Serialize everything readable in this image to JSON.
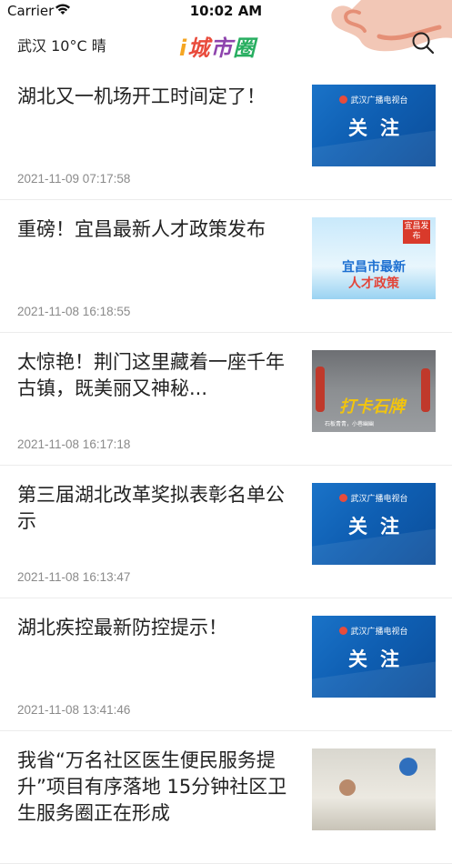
{
  "status_bar": {
    "carrier": "Carrier",
    "time": "10:02 AM"
  },
  "header": {
    "weather": "武汉 10°C 晴",
    "logo_chars": [
      "i",
      "城",
      "市",
      "圈",
      ""
    ],
    "search_icon": "search-icon"
  },
  "news": [
    {
      "title": "湖北又一机场开工时间定了！",
      "time": "2021-11-09 07:17:58",
      "thumb": {
        "type": "tv",
        "station": "武汉广播电视台",
        "text": "关注"
      }
    },
    {
      "title": "重磅！宜昌最新人才政策发布",
      "time": "2021-11-08 16:18:55",
      "thumb": {
        "type": "yichang",
        "badge": "宜昌发布",
        "line1": "宜昌市最新",
        "line2": "人才政策"
      }
    },
    {
      "title": "太惊艳！荆门这里藏着一座千年古镇，既美丽又神秘...",
      "time": "2021-11-08 16:17:18",
      "thumb": {
        "type": "town",
        "logo": "打卡石牌",
        "sub": "石板青青，小巷幽幽"
      }
    },
    {
      "title": "第三届湖北改革奖拟表彰名单公示",
      "time": "2021-11-08 16:13:47",
      "thumb": {
        "type": "tv",
        "station": "武汉广播电视台",
        "text": "关注"
      }
    },
    {
      "title": "湖北疾控最新防控提示！",
      "time": "2021-11-08 13:41:46",
      "thumb": {
        "type": "tv",
        "station": "武汉广播电视台",
        "text": "关注"
      }
    },
    {
      "title": "我省“万名社区医生便民服务提升”项目有序落地 15分钟社区卫生服务圈正在形成",
      "time": "",
      "thumb": {
        "type": "clinic"
      }
    }
  ]
}
